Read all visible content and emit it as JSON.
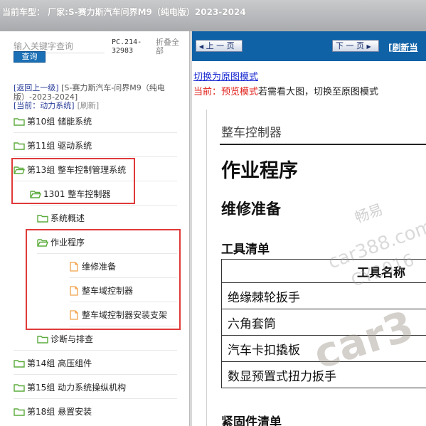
{
  "header": {
    "title": "当前车型：  厂家:S-赛力斯汽车问界M9（纯电版）2023-2024"
  },
  "sidebar": {
    "search_placeholder": "输入关键字查询",
    "search_button": "查询",
    "pc_info": "PC.214-\n32983",
    "fold_all": "折叠全部",
    "back_link": "[返回上一级]",
    "back_model": "[S-赛力斯汽车-问界M9（纯电版）-2023-2024]",
    "current_label": "[当前：动力系统]",
    "refresh": "[刷新]",
    "tree": [
      {
        "label": "第10组 储能系统",
        "type": "folder"
      },
      {
        "label": "第11组 驱动系统",
        "type": "folder"
      },
      {
        "label": "第13组 整车控制管理系统",
        "type": "folder-open"
      },
      {
        "label": "1301 整车控制器",
        "type": "folder-open"
      },
      {
        "label": "系统概述",
        "type": "folder"
      },
      {
        "label": "作业程序",
        "type": "folder-open"
      },
      {
        "label": "维修准备",
        "type": "doc"
      },
      {
        "label": "整车域控制器",
        "type": "doc"
      },
      {
        "label": "整车域控制器安装支架",
        "type": "doc"
      },
      {
        "label": "诊断与排查",
        "type": "folder"
      },
      {
        "label": "第14组 高压组件",
        "type": "folder"
      },
      {
        "label": "第15组 动力系统操纵机构",
        "type": "folder"
      },
      {
        "label": "第18组 悬置安装",
        "type": "folder"
      }
    ]
  },
  "toolbar": {
    "prev_page": "上 一 页",
    "next_page": "下 一 页",
    "refresh_page": "[刷新当"
  },
  "content": {
    "switch_link": "切换为原图模式",
    "mode_current": "当前：",
    "mode_name": "预览模式",
    "mode_hint": "若需看大图，切换至原图模式",
    "doc_title": "整车控制器",
    "h1": "作业程序",
    "h2": "维修准备",
    "tools_heading": "工具清单",
    "tools_column": "工具名称",
    "tools": [
      "绝缘棘轮扳手",
      "六角套筒",
      "汽车卡扣撬板",
      "数显预置式扭力扳手"
    ],
    "fasteners_heading": "紧固件清单"
  },
  "watermark": {
    "line1": "畅易",
    "line2": "car388.com",
    "line3": "CY2016",
    "big": "car3"
  },
  "colors": {
    "accent_blue": "#1062a6",
    "highlight_red": "#e03a3a",
    "folder_green": "#5cab3c",
    "doc_orange": "#f2a24b"
  }
}
